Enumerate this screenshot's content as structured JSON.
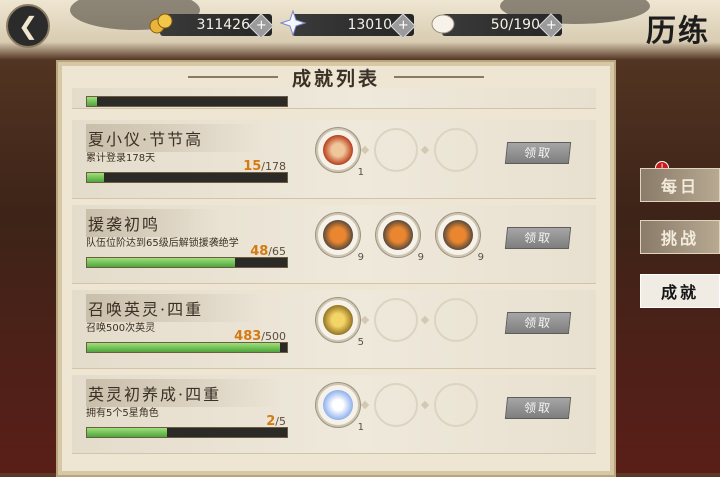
{
  "header": {
    "screen_title": "历练",
    "back_icon": "back-arrow-icon",
    "resources": [
      {
        "icon": "coins-icon",
        "value": "311426"
      },
      {
        "icon": "star-crystal-icon",
        "value": "13010"
      },
      {
        "icon": "stamina-rice-icon",
        "value": "50/190"
      }
    ]
  },
  "panel": {
    "title": "成就列表"
  },
  "achievements": [
    {
      "name": "夏小仪·节节高",
      "desc": "累计登录178天",
      "current": "15",
      "total": "/178",
      "progress": 0.084,
      "rewards": [
        {
          "icon": "hero-portrait-icon",
          "qty": "1"
        }
      ],
      "claim": "领取"
    },
    {
      "name": "援袭初鸣",
      "desc": "队伍位阶达到65级后解锁援袭绝学",
      "current": "48",
      "total": "/65",
      "progress": 0.738,
      "rewards": [
        {
          "icon": "skill-book-icon",
          "qty": "9"
        },
        {
          "icon": "skill-book-icon",
          "qty": "9"
        },
        {
          "icon": "skill-book-icon",
          "qty": "9"
        }
      ],
      "claim": "领取"
    },
    {
      "name": "召唤英灵·四重",
      "desc": "召唤500次英灵",
      "current": "483",
      "total": "/500",
      "progress": 0.966,
      "rewards": [
        {
          "icon": "summon-token-icon",
          "qty": "5"
        }
      ],
      "claim": "领取"
    },
    {
      "name": "英灵初养成·四重",
      "desc": "拥有5个5星角色",
      "current": "2",
      "total": "/5",
      "progress": 0.4,
      "rewards": [
        {
          "icon": "crystal-shard-icon",
          "qty": "1"
        }
      ],
      "claim": "领取"
    }
  ],
  "tabs": [
    {
      "label": "每日",
      "active": false,
      "badge": "!"
    },
    {
      "label": "挑战",
      "active": false
    },
    {
      "label": "成就",
      "active": true
    }
  ],
  "colors": {
    "progress_fill": "#4fa43c",
    "count_current": "#d47a10",
    "badge": "#c8191b"
  }
}
